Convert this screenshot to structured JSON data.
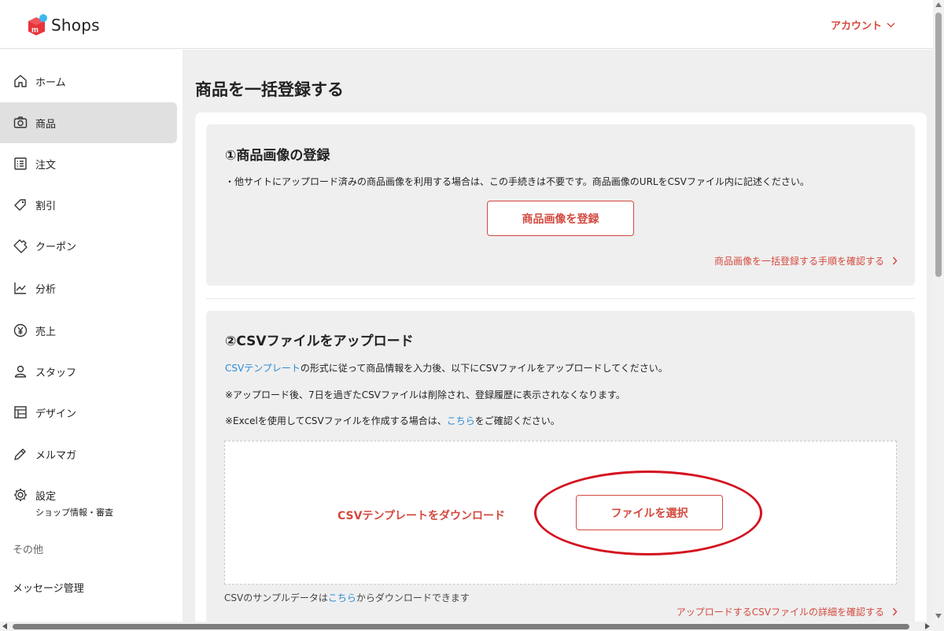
{
  "header": {
    "logo_text": "Shops",
    "account_label": "アカウント",
    "brand_color": "#e8333b"
  },
  "sidebar": {
    "items": [
      {
        "label": "ホーム",
        "icon": "home-icon"
      },
      {
        "label": "商品",
        "icon": "camera-icon",
        "active": true
      },
      {
        "label": "注文",
        "icon": "list-icon"
      },
      {
        "label": "割引",
        "icon": "tag-icon"
      },
      {
        "label": "クーポン",
        "icon": "ticket-icon"
      },
      {
        "label": "分析",
        "icon": "chart-icon"
      },
      {
        "label": "売上",
        "icon": "yen-icon"
      },
      {
        "label": "スタッフ",
        "icon": "person-icon"
      },
      {
        "label": "デザイン",
        "icon": "layout-icon"
      },
      {
        "label": "メルマガ",
        "icon": "pen-icon"
      },
      {
        "label": "設定",
        "sub": "ショップ情報・審査",
        "icon": "gear-icon"
      }
    ],
    "section_other": "その他",
    "message_label": "メッセージ管理"
  },
  "main": {
    "title": "商品を一括登録する",
    "section1": {
      "title": "①商品画像の登録",
      "note": "・他サイトにアップロード済みの商品画像を利用する場合は、この手続きは不要です。商品画像のURLをCSVファイル内に記述ください。",
      "button": "商品画像を登録",
      "link": "商品画像を一括登録する手順を確認する"
    },
    "section2": {
      "title": "②CSVファイルをアップロード",
      "line1_link": "CSVテンプレート",
      "line1_rest": "の形式に従って商品情報を入力後、以下にCSVファイルをアップロードしてください。",
      "line2": "※アップロード後、7日を過ぎたCSVファイルは削除され、登録履歴に表示されなくなります。",
      "line3_pre": "※Excelを使用してCSVファイルを作成する場合は、",
      "line3_link": "こちら",
      "line3_post": "をご確認ください。",
      "download_template": "CSVテンプレートをダウンロード",
      "select_file": "ファイルを選択",
      "sample_pre": "CSVのサンプルデータは",
      "sample_link": "こちら",
      "sample_post": "からダウンロードできます",
      "detail_link": "アップロードするCSVファイルの詳細を確認する"
    }
  },
  "colors": {
    "accent": "#d34a3f",
    "link": "#2a8bd6",
    "annotation": "#d4121f"
  }
}
